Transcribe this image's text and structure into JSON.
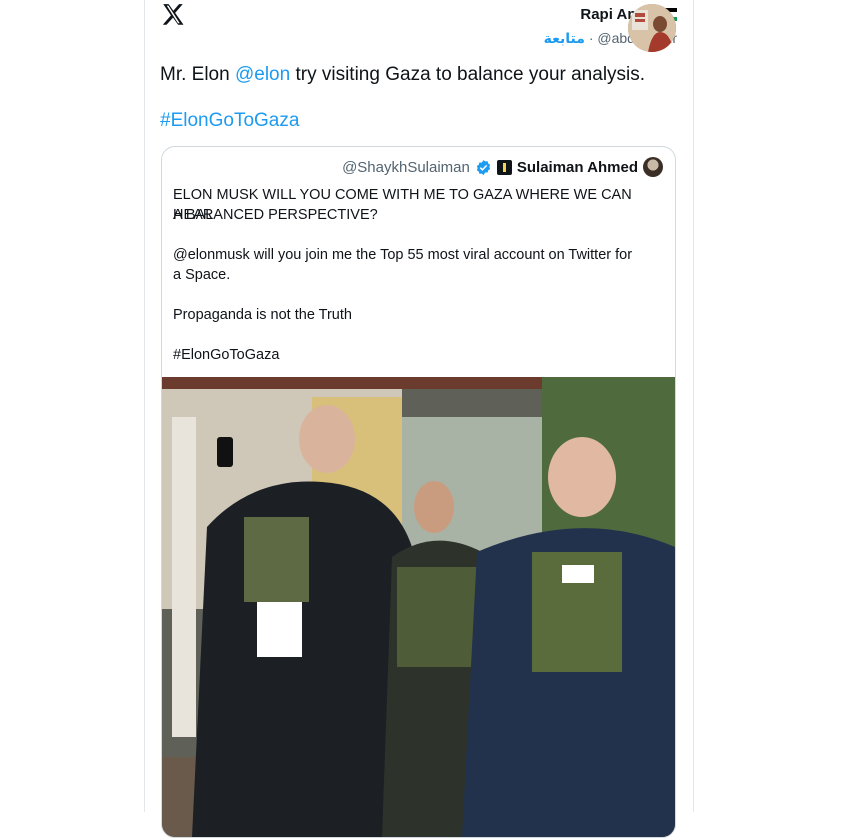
{
  "post": {
    "author_name": "Rapi Amat",
    "author_handle": "@abdul_hair",
    "separator": "·",
    "follow_label": "متابعة",
    "text_before": "Mr. Elon ",
    "mention": "@elon",
    "text_after": " try visiting Gaza to balance your analysis.",
    "hashtag": "#ElonGoToGaza"
  },
  "quoted": {
    "handle": "@ShaykhSulaiman",
    "name": "Sulaiman Ahmed",
    "lines": [
      "ELON MUSK WILL YOU COME WITH ME TO GAZA WHERE WE CAN HEAR",
      "A BALANCED PERSPECTIVE?",
      "@elonmusk will you join me the Top 55 most viral account on Twitter for",
      "a Space.",
      "Propaganda is not the Truth",
      "#ElonGoToGaza"
    ]
  },
  "colors": {
    "accent": "#1d9bf0",
    "text": "#0f1419",
    "muted": "#536471",
    "border": "#cfd9de"
  },
  "icons": [
    "x-logo-icon",
    "palestine-flag-icon",
    "verified-badge-icon",
    "affiliate-badge-icon"
  ]
}
